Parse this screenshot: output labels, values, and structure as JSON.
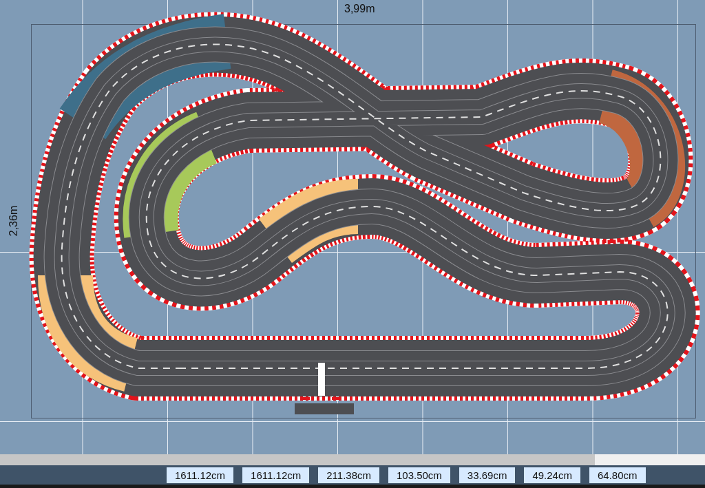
{
  "board": {
    "width_label": "3,99m",
    "height_label": "2,36m"
  },
  "status_bar": {
    "values": [
      "1611.12cm",
      "1611.12cm",
      "211.38cm",
      "103.50cm",
      "33.69cm",
      "49.24cm",
      "64.80cm"
    ]
  }
}
